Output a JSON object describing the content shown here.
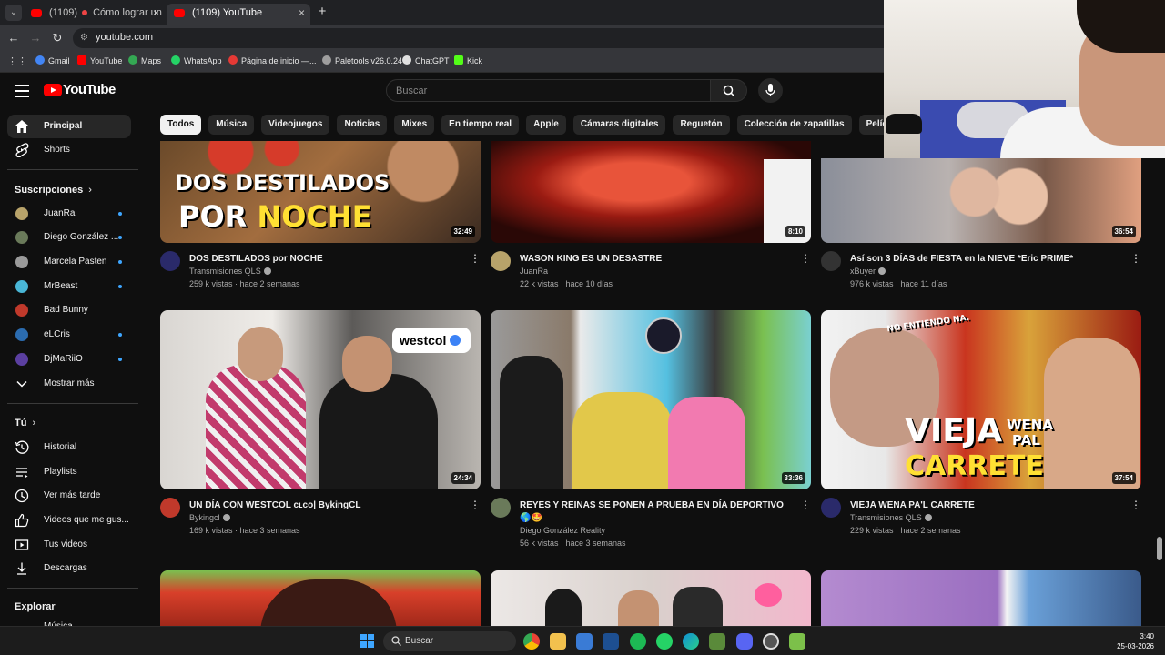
{
  "browser": {
    "tabs": [
      {
        "label": "(1109)",
        "label2": "Cómo lograr un aud",
        "close": "×"
      },
      {
        "label": "(1109) YouTube",
        "close": "×"
      }
    ],
    "new_tab": "+",
    "url": "youtube.com",
    "bookmarks": [
      {
        "label": "Gmail",
        "color": "#4285f4"
      },
      {
        "label": "YouTube",
        "color": "#ff0000"
      },
      {
        "label": "Maps",
        "color": "#34a853"
      },
      {
        "label": "WhatsApp",
        "color": "#25d366"
      },
      {
        "label": "Página de inicio —...",
        "color": "#e53935"
      },
      {
        "label": "Paletools v26.0.24",
        "color": "#9e9e9e"
      },
      {
        "label": "ChatGPT",
        "color": "#e0e0e0"
      },
      {
        "label": "Kick",
        "color": "#53fc18"
      }
    ]
  },
  "header": {
    "logo_text": "YouTube",
    "search_placeholder": "Buscar"
  },
  "chips": [
    "Todos",
    "Música",
    "Videojuegos",
    "Noticias",
    "Mixes",
    "En tiempo real",
    "Apple",
    "Cámaras digitales",
    "Reguetón",
    "Colección de zapatillas",
    "Película de superhéroes"
  ],
  "sidebar": {
    "main": [
      {
        "label": "Principal",
        "icon": "home-icon"
      },
      {
        "label": "Shorts",
        "icon": "shorts-icon"
      }
    ],
    "subs_title": "Suscripciones",
    "subs": [
      {
        "label": "JuanRa",
        "color": "#b8a36a"
      },
      {
        "label": "Diego González ...",
        "color": "#6a7a5a"
      },
      {
        "label": "Marcela Pasten",
        "color": "#9a9a9a"
      },
      {
        "label": "MrBeast",
        "color": "#49b6d6"
      },
      {
        "label": "Bad Bunny",
        "color": "#c0392b"
      },
      {
        "label": "eLCris",
        "color": "#2b6cb0"
      },
      {
        "label": "DjMaRiiO",
        "color": "#5b3fa0"
      }
    ],
    "show_more": "Mostrar más",
    "you_title": "Tú",
    "you": [
      {
        "label": "Historial",
        "icon": "history-icon"
      },
      {
        "label": "Playlists",
        "icon": "playlists-icon"
      },
      {
        "label": "Ver más tarde",
        "icon": "watch-later-icon"
      },
      {
        "label": "Videos que me gus...",
        "icon": "liked-icon"
      },
      {
        "label": "Tus videos",
        "icon": "your-videos-icon"
      },
      {
        "label": "Descargas",
        "icon": "downloads-icon"
      }
    ],
    "explore_title": "Explorar",
    "explore_partial": "Música"
  },
  "videos": [
    {
      "title": "DOS DESTILADOS por NOCHE",
      "channel": "Transmisiones QLS",
      "verified": true,
      "stats": "259 k vistas · hace 2 semanas",
      "duration": "32:49",
      "avatar": "#2a2a6a",
      "thumb_lines": [
        "DOS DESTILADOS",
        "POR",
        "NOCHE"
      ]
    },
    {
      "title": "WASON KING ES UN DESASTRE",
      "channel": "JuanRa",
      "verified": false,
      "stats": "22 k vistas · hace 10 días",
      "duration": "8:10",
      "avatar": "#b8a36a"
    },
    {
      "title": "Así son 3 DÍAS de FIESTA en la NIEVE *Eric PRIME*",
      "channel": "xBuyer",
      "verified": true,
      "stats": "976 k vistas · hace 11 días",
      "duration": "36:54",
      "avatar": "#333333"
    },
    {
      "title": "UN DÍA CON WESTCOL ᴄʟᴄᴏ| BykingCL",
      "channel": "Bykingcl",
      "verified": true,
      "stats": "169 k vistas · hace 3 semanas",
      "duration": "24:34",
      "avatar": "#c0392b",
      "thumb_badge": "westcol"
    },
    {
      "title": "REYES Y REINAS SE PONEN A PRUEBA EN DÍA DEPORTIVO 🌎🤩",
      "channel": "Diego González Reality",
      "verified": false,
      "stats": "56 k vistas · hace 3 semanas",
      "duration": "33:36",
      "avatar": "#6a7a5a"
    },
    {
      "title": "VIEJA WENA PA'L CARRETE",
      "channel": "Transmisiones QLS",
      "verified": true,
      "stats": "229 k vistas · hace 2 semanas",
      "duration": "37:54",
      "avatar": "#2a2a6a",
      "thumb_lines": [
        "NO ENTIENDO NA.",
        "VIEJA",
        "WENA",
        "PAL",
        "CARRETE"
      ]
    }
  ],
  "taskbar": {
    "search_placeholder": "Buscar",
    "time": "3:40",
    "date": "25-03-2026"
  }
}
